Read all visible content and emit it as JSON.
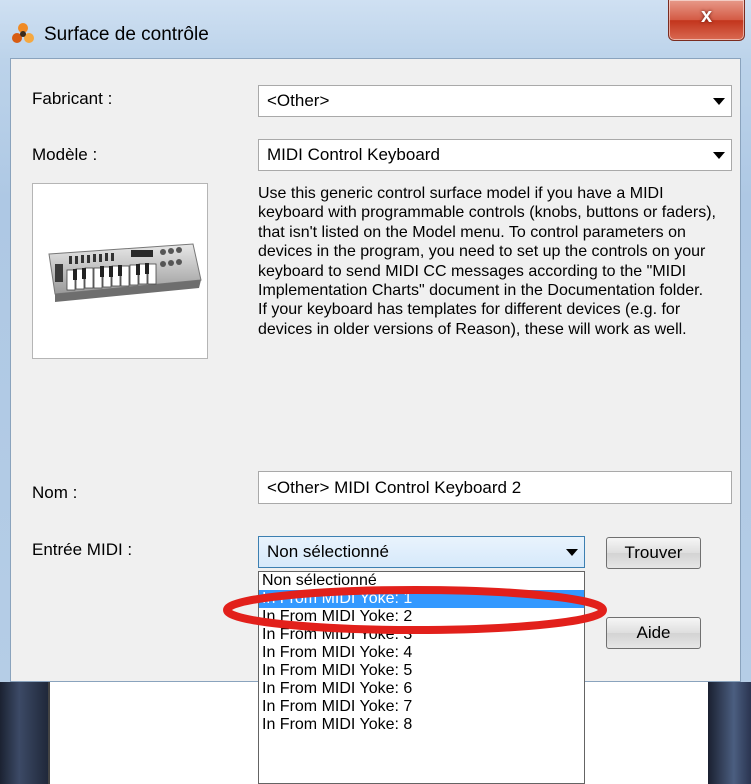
{
  "window": {
    "title": "Surface de contrôle",
    "close_glyph": "x"
  },
  "form": {
    "manufacturer_label": "Fabricant :",
    "manufacturer_value": "<Other>",
    "model_label": "Modèle :",
    "model_value": "MIDI Control Keyboard",
    "description": [
      "Use this generic control surface model if you have a MIDI keyboard with programmable controls (knobs, buttons or faders), that isn't listed on the Model menu. To control parameters on devices in the program, you need to set up the controls on your keyboard to send MIDI CC messages according to the \"MIDI Implementation Charts\" document in the Documentation folder.",
      "If your keyboard has templates for different devices (e.g. for devices in older versions of Reason), these will work as well."
    ],
    "name_label": "Nom :",
    "name_value": "<Other> MIDI Control Keyboard 2",
    "midi_input_label": "Entrée MIDI :",
    "midi_input_value": "Non sélectionné",
    "find_button": "Trouver",
    "help_button": "Aide"
  },
  "dropdown": {
    "items": [
      "Non sélectionné",
      "In From MIDI Yoke:  1",
      "In From MIDI Yoke:  2",
      "In From MIDI Yoke:  3",
      "In From MIDI Yoke:  4",
      "In From MIDI Yoke:  5",
      "In From MIDI Yoke:  6",
      "In From MIDI Yoke:  7",
      "In From MIDI Yoke:  8"
    ],
    "selected_index": 1
  },
  "icons": {
    "app_icon": "reason-app-icon",
    "preview": "midi-keyboard-image"
  },
  "colors": {
    "selection": "#3399ff",
    "annotation": "#e2201b",
    "close": "#c2341c"
  }
}
